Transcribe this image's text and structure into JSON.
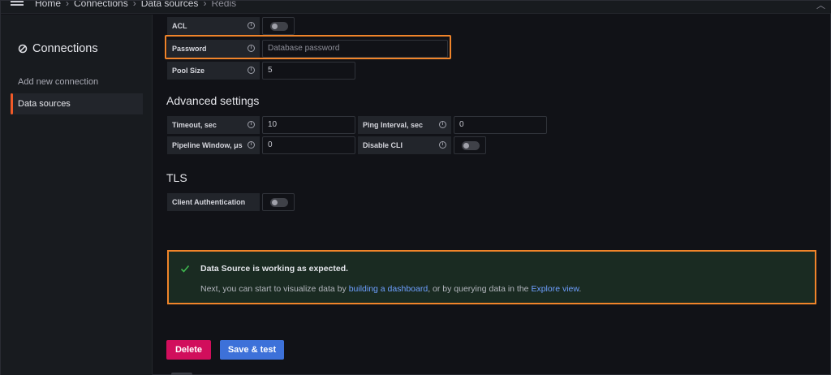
{
  "breadcrumb": {
    "items": [
      "Home",
      "Connections",
      "Data sources"
    ],
    "current": "Redis",
    "separator": "›"
  },
  "sidebar": {
    "title": "Connections",
    "items": [
      {
        "label": "Add new connection",
        "active": false
      },
      {
        "label": "Data sources",
        "active": true
      }
    ]
  },
  "form": {
    "acl_label": "ACL",
    "password_label": "Password",
    "password_placeholder": "Database password",
    "pool_size_label": "Pool Size",
    "pool_size_value": "5",
    "advanced_title": "Advanced settings",
    "timeout_label": "Timeout, sec",
    "timeout_value": "10",
    "ping_label": "Ping Interval, sec",
    "ping_value": "0",
    "pipeline_label": "Pipeline Window, μs",
    "pipeline_value": "0",
    "disable_cli_label": "Disable CLI",
    "tls_title": "TLS",
    "client_auth_label": "Client Authentication"
  },
  "alert": {
    "title": "Data Source is working as expected.",
    "text_before": "Next, you can start to visualize data by ",
    "link1": "building a dashboard",
    "text_middle": ", or by querying data in the ",
    "link2": "Explore view",
    "text_end": "."
  },
  "actions": {
    "delete_label": "Delete",
    "save_label": "Save & test"
  },
  "colors": {
    "accent_orange": "#f05a28",
    "highlight_orange": "#f0842a",
    "success_green": "#3fb950",
    "delete_red": "#d10e5c",
    "primary_blue": "#3d71d9",
    "link_blue": "#6e9fff"
  },
  "icons": {
    "menu": "hamburger-icon",
    "connections": "plug-icon",
    "info": "info-icon",
    "success": "checkmark-icon",
    "expand": "chevron-up-icon"
  }
}
